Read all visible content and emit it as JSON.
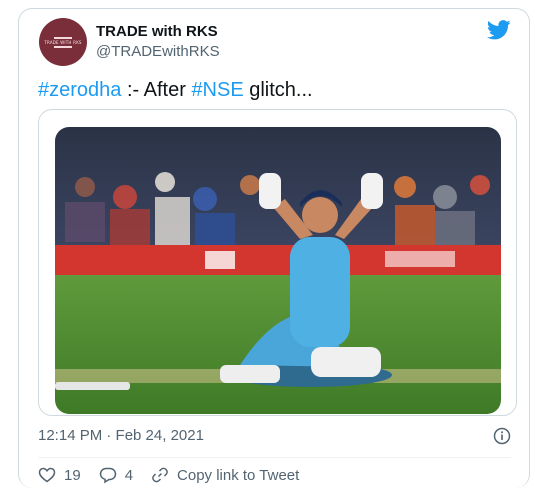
{
  "author": {
    "name": "TRADE with RKS",
    "handle": "@TRADEwithRKS",
    "avatar_text": "TRADE WITH RKS"
  },
  "tweet": {
    "hashtag1": "#zerodha",
    "text_middle": " :- After ",
    "hashtag2": "#NSE",
    "text_end": " glitch..."
  },
  "meta": {
    "timestamp": "12:14 PM · Feb 24, 2021"
  },
  "actions": {
    "likes": "19",
    "replies": "4",
    "copy_link": "Copy link to Tweet"
  },
  "colors": {
    "accent": "#1d9bf0",
    "text": "#0f1419",
    "muted": "#536471",
    "border": "#cfd9de",
    "avatar_bg": "#7a2e3a"
  },
  "icons": [
    "twitter-bird-icon",
    "info-icon",
    "heart-icon",
    "reply-icon",
    "link-icon"
  ]
}
